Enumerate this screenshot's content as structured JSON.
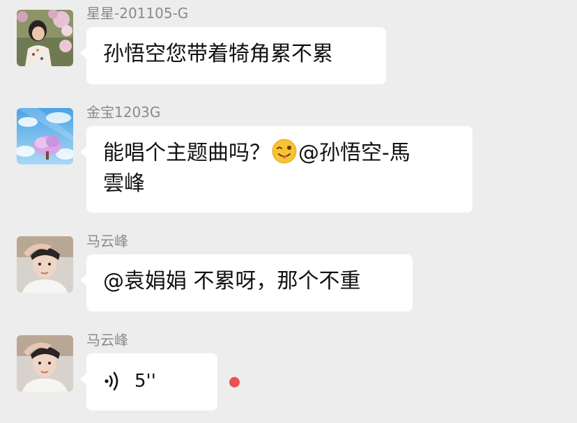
{
  "messages": [
    {
      "sender": "星星-201105-G",
      "text": "孙悟空您带着犄角累不累"
    },
    {
      "sender": "金宝1203G",
      "text_before_emoji": "能唱个主题曲吗？",
      "emoji": "winking-face-with-tongue",
      "text_after_emoji_line1": "@孙悟空-馬",
      "text_line2": "雲峰"
    },
    {
      "sender": "马云峰",
      "text": "@袁娟娟 不累呀，那个不重"
    },
    {
      "sender": "马云峰",
      "voice_duration": "5''",
      "voice_icon": "voice-wave-icon",
      "unread": true
    }
  ],
  "colors": {
    "background": "#ededed",
    "bubble": "#ffffff",
    "sender_text": "#8a8a8a",
    "unread_dot": "#e75252"
  }
}
